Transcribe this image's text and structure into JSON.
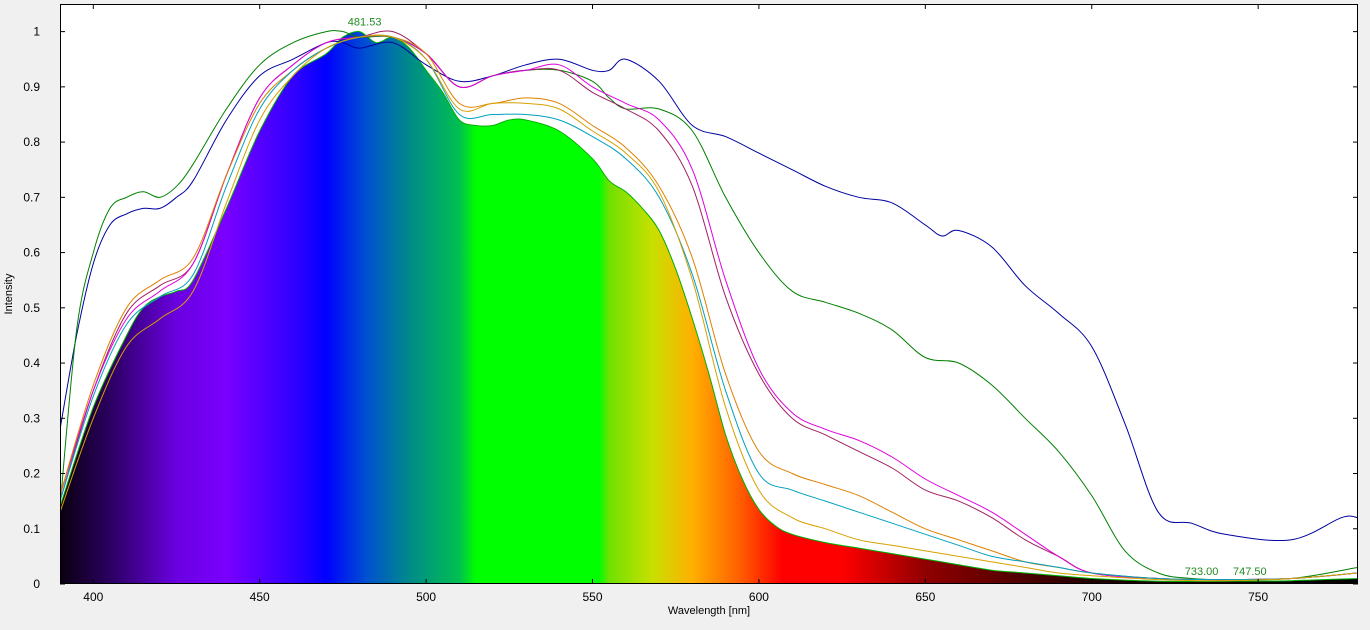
{
  "chart_data": {
    "type": "line",
    "xlabel": "Wavelength [nm]",
    "ylabel": "Intensity",
    "xlim": [
      390,
      780
    ],
    "ylim": [
      0,
      1.05
    ],
    "xticks": [
      "400",
      "450",
      "500",
      "550",
      "600",
      "650",
      "700",
      "750"
    ],
    "yticks": [
      "0",
      "0.1",
      "0.2",
      "0.3",
      "0.4",
      "0.5",
      "0.6",
      "0.7",
      "0.8",
      "0.9",
      "1"
    ],
    "grid": false,
    "legend": "none",
    "annotations": [
      {
        "text": "481.53",
        "x": 481.53,
        "y": 1.0,
        "color": "#228b22"
      },
      {
        "text": "733.00",
        "x": 733.0,
        "y": 0.0,
        "color": "#228b22"
      },
      {
        "text": "747.50",
        "x": 747.5,
        "y": 0.0,
        "color": "#228b22"
      }
    ],
    "spectrum_fill": {
      "description_color_stops": [
        {
          "x": 390,
          "color": "#0a0010"
        },
        {
          "x": 405,
          "color": "#2a0060"
        },
        {
          "x": 425,
          "color": "#6a00e0"
        },
        {
          "x": 440,
          "color": "#7a00ff"
        },
        {
          "x": 462,
          "color": "#2a00ff"
        },
        {
          "x": 470,
          "color": "#0000ff"
        },
        {
          "x": 482,
          "color": "#0050d0"
        },
        {
          "x": 495,
          "color": "#008a8a"
        },
        {
          "x": 510,
          "color": "#00c050"
        },
        {
          "x": 515,
          "color": "#00ff00"
        },
        {
          "x": 552,
          "color": "#00ff00"
        },
        {
          "x": 555,
          "color": "#70e000"
        },
        {
          "x": 568,
          "color": "#c8e000"
        },
        {
          "x": 580,
          "color": "#ffb000"
        },
        {
          "x": 594,
          "color": "#ff6000"
        },
        {
          "x": 607,
          "color": "#ff0000"
        },
        {
          "x": 625,
          "color": "#ff0000"
        },
        {
          "x": 650,
          "color": "#900000"
        },
        {
          "x": 700,
          "color": "#200000"
        },
        {
          "x": 780,
          "color": "#000000"
        }
      ],
      "x": [
        390,
        400,
        410,
        415,
        420,
        425,
        430,
        440,
        450,
        460,
        470,
        475,
        480,
        485,
        490,
        495,
        500,
        505,
        510,
        515,
        520,
        525,
        530,
        540,
        550,
        555,
        560,
        565,
        570,
        575,
        580,
        585,
        590,
        595,
        600,
        605,
        610,
        620,
        630,
        640,
        650,
        660,
        670,
        680,
        690,
        700,
        720,
        740,
        760,
        780
      ],
      "y": [
        0.14,
        0.32,
        0.45,
        0.5,
        0.52,
        0.53,
        0.55,
        0.68,
        0.82,
        0.92,
        0.96,
        0.99,
        1.0,
        0.98,
        0.99,
        0.97,
        0.93,
        0.89,
        0.84,
        0.83,
        0.83,
        0.84,
        0.84,
        0.82,
        0.77,
        0.73,
        0.71,
        0.68,
        0.64,
        0.57,
        0.48,
        0.38,
        0.27,
        0.19,
        0.135,
        0.105,
        0.09,
        0.075,
        0.065,
        0.055,
        0.045,
        0.035,
        0.025,
        0.02,
        0.015,
        0.01,
        0.005,
        0.005,
        0.006,
        0.01
      ]
    },
    "series": [
      {
        "color": "#0000a0",
        "x": [
          390,
          395,
          400,
          405,
          410,
          415,
          420,
          425,
          430,
          440,
          450,
          460,
          470,
          475,
          480,
          490,
          500,
          510,
          520,
          530,
          540,
          550,
          555,
          560,
          570,
          580,
          590,
          600,
          610,
          620,
          630,
          640,
          650,
          655,
          660,
          670,
          680,
          690,
          700,
          710,
          720,
          730,
          740,
          760,
          775,
          780
        ],
        "values": [
          0.28,
          0.45,
          0.58,
          0.65,
          0.67,
          0.68,
          0.68,
          0.7,
          0.73,
          0.84,
          0.92,
          0.95,
          0.98,
          0.98,
          0.97,
          0.98,
          0.94,
          0.91,
          0.92,
          0.94,
          0.95,
          0.93,
          0.93,
          0.95,
          0.91,
          0.83,
          0.81,
          0.78,
          0.75,
          0.72,
          0.7,
          0.69,
          0.65,
          0.63,
          0.64,
          0.61,
          0.54,
          0.49,
          0.43,
          0.29,
          0.13,
          0.11,
          0.09,
          0.08,
          0.12,
          0.12
        ]
      },
      {
        "color": "#008000",
        "x": [
          390,
          395,
          400,
          405,
          410,
          415,
          420,
          425,
          430,
          440,
          450,
          460,
          470,
          475,
          480,
          490,
          500,
          510,
          520,
          530,
          540,
          550,
          555,
          560,
          570,
          580,
          590,
          600,
          610,
          620,
          630,
          640,
          650,
          660,
          670,
          680,
          690,
          700,
          710,
          720,
          730,
          740,
          760,
          780
        ],
        "values": [
          0.14,
          0.46,
          0.6,
          0.68,
          0.7,
          0.71,
          0.7,
          0.72,
          0.76,
          0.86,
          0.94,
          0.98,
          1.0,
          1.0,
          0.99,
          0.99,
          0.96,
          0.9,
          0.92,
          0.93,
          0.93,
          0.91,
          0.88,
          0.86,
          0.86,
          0.82,
          0.7,
          0.6,
          0.53,
          0.51,
          0.49,
          0.46,
          0.41,
          0.4,
          0.36,
          0.3,
          0.24,
          0.16,
          0.06,
          0.02,
          0.01,
          0.008,
          0.01,
          0.03
        ]
      },
      {
        "color": "#a02060",
        "x": [
          390,
          400,
          410,
          420,
          430,
          440,
          450,
          460,
          470,
          480,
          490,
          500,
          510,
          520,
          530,
          540,
          550,
          560,
          570,
          580,
          590,
          600,
          610,
          620,
          630,
          640,
          650,
          660,
          670,
          680,
          690,
          700,
          720,
          740,
          760,
          780
        ],
        "values": [
          0.15,
          0.35,
          0.49,
          0.54,
          0.58,
          0.74,
          0.88,
          0.94,
          0.98,
          0.99,
          1.0,
          0.96,
          0.9,
          0.92,
          0.93,
          0.93,
          0.89,
          0.86,
          0.82,
          0.72,
          0.52,
          0.38,
          0.3,
          0.27,
          0.24,
          0.21,
          0.17,
          0.15,
          0.12,
          0.08,
          0.05,
          0.02,
          0.01,
          0.008,
          0.01,
          0.02
        ]
      },
      {
        "color": "#e000e0",
        "x": [
          390,
          400,
          410,
          420,
          430,
          440,
          450,
          460,
          470,
          480,
          490,
          500,
          510,
          520,
          530,
          540,
          550,
          560,
          570,
          580,
          590,
          600,
          610,
          620,
          630,
          640,
          650,
          660,
          670,
          680,
          690,
          700,
          720,
          740,
          760,
          780
        ],
        "values": [
          0.16,
          0.35,
          0.48,
          0.53,
          0.58,
          0.74,
          0.88,
          0.94,
          0.98,
          0.99,
          0.99,
          0.96,
          0.9,
          0.92,
          0.93,
          0.94,
          0.9,
          0.87,
          0.84,
          0.75,
          0.55,
          0.39,
          0.31,
          0.28,
          0.26,
          0.23,
          0.19,
          0.16,
          0.13,
          0.09,
          0.05,
          0.02,
          0.01,
          0.008,
          0.01,
          0.02
        ]
      },
      {
        "color": "#e08000",
        "x": [
          390,
          400,
          410,
          420,
          430,
          440,
          450,
          460,
          470,
          480,
          490,
          500,
          510,
          520,
          530,
          540,
          550,
          560,
          570,
          580,
          590,
          600,
          610,
          620,
          630,
          640,
          650,
          660,
          670,
          680,
          690,
          700,
          720,
          740,
          760,
          780
        ],
        "values": [
          0.16,
          0.36,
          0.5,
          0.55,
          0.59,
          0.74,
          0.87,
          0.93,
          0.97,
          0.99,
          0.99,
          0.96,
          0.87,
          0.87,
          0.88,
          0.87,
          0.83,
          0.79,
          0.72,
          0.59,
          0.38,
          0.24,
          0.2,
          0.18,
          0.16,
          0.13,
          0.1,
          0.08,
          0.06,
          0.04,
          0.03,
          0.02,
          0.01,
          0.008,
          0.01,
          0.02
        ]
      },
      {
        "color": "#00a0c0",
        "x": [
          390,
          400,
          410,
          420,
          430,
          440,
          450,
          460,
          470,
          480,
          490,
          500,
          510,
          520,
          530,
          540,
          550,
          560,
          570,
          580,
          590,
          600,
          610,
          620,
          630,
          640,
          650,
          660,
          670,
          680,
          690,
          700,
          720,
          740,
          760,
          780
        ],
        "values": [
          0.15,
          0.34,
          0.47,
          0.52,
          0.56,
          0.72,
          0.86,
          0.93,
          0.97,
          0.99,
          0.99,
          0.95,
          0.85,
          0.85,
          0.85,
          0.84,
          0.81,
          0.77,
          0.7,
          0.56,
          0.35,
          0.2,
          0.17,
          0.15,
          0.13,
          0.11,
          0.09,
          0.07,
          0.05,
          0.04,
          0.03,
          0.02,
          0.01,
          0.008,
          0.01,
          0.02
        ]
      },
      {
        "color": "#d8a000",
        "x": [
          390,
          400,
          410,
          420,
          430,
          440,
          450,
          460,
          470,
          480,
          490,
          500,
          510,
          520,
          530,
          540,
          550,
          560,
          570,
          580,
          590,
          600,
          610,
          620,
          630,
          640,
          650,
          660,
          670,
          680,
          690,
          700,
          720,
          740,
          760,
          780
        ],
        "values": [
          0.13,
          0.3,
          0.43,
          0.48,
          0.53,
          0.69,
          0.84,
          0.92,
          0.97,
          0.99,
          0.99,
          0.95,
          0.86,
          0.87,
          0.87,
          0.86,
          0.82,
          0.78,
          0.71,
          0.55,
          0.32,
          0.17,
          0.12,
          0.1,
          0.08,
          0.07,
          0.06,
          0.05,
          0.04,
          0.03,
          0.02,
          0.015,
          0.008,
          0.006,
          0.01,
          0.02
        ]
      }
    ]
  }
}
